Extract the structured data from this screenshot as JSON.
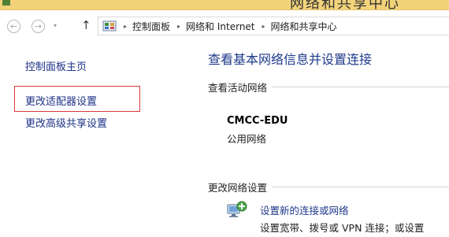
{
  "titlebar": {
    "title": "网络和共享中心"
  },
  "nav": {
    "back_glyph": "←",
    "forward_glyph": "→",
    "recent_glyph": "▾",
    "up_glyph": "↑"
  },
  "address": {
    "icon": "control-panel-icon",
    "separator": "▸",
    "crumbs": [
      "控制面板",
      "网络和 Internet",
      "网络和共享中心"
    ]
  },
  "sidebar": {
    "home_link": "控制面板主页",
    "adapter_link": "更改适配器设置",
    "advanced_link": "更改高级共享设置"
  },
  "main": {
    "title": "查看基本网络信息并设置连接",
    "active_networks_label": "查看活动网络",
    "network": {
      "name": "CMCC-EDU",
      "type": "公用网络"
    },
    "change_settings_label": "更改网络设置",
    "setup": {
      "link": "设置新的连接或网络",
      "description": "设置宽带、拨号或 VPN 连接；或设置"
    }
  },
  "colors": {
    "link": "#1e3a8a",
    "highlight_box": "#d8383c",
    "titlebar": "#f3d37a"
  }
}
